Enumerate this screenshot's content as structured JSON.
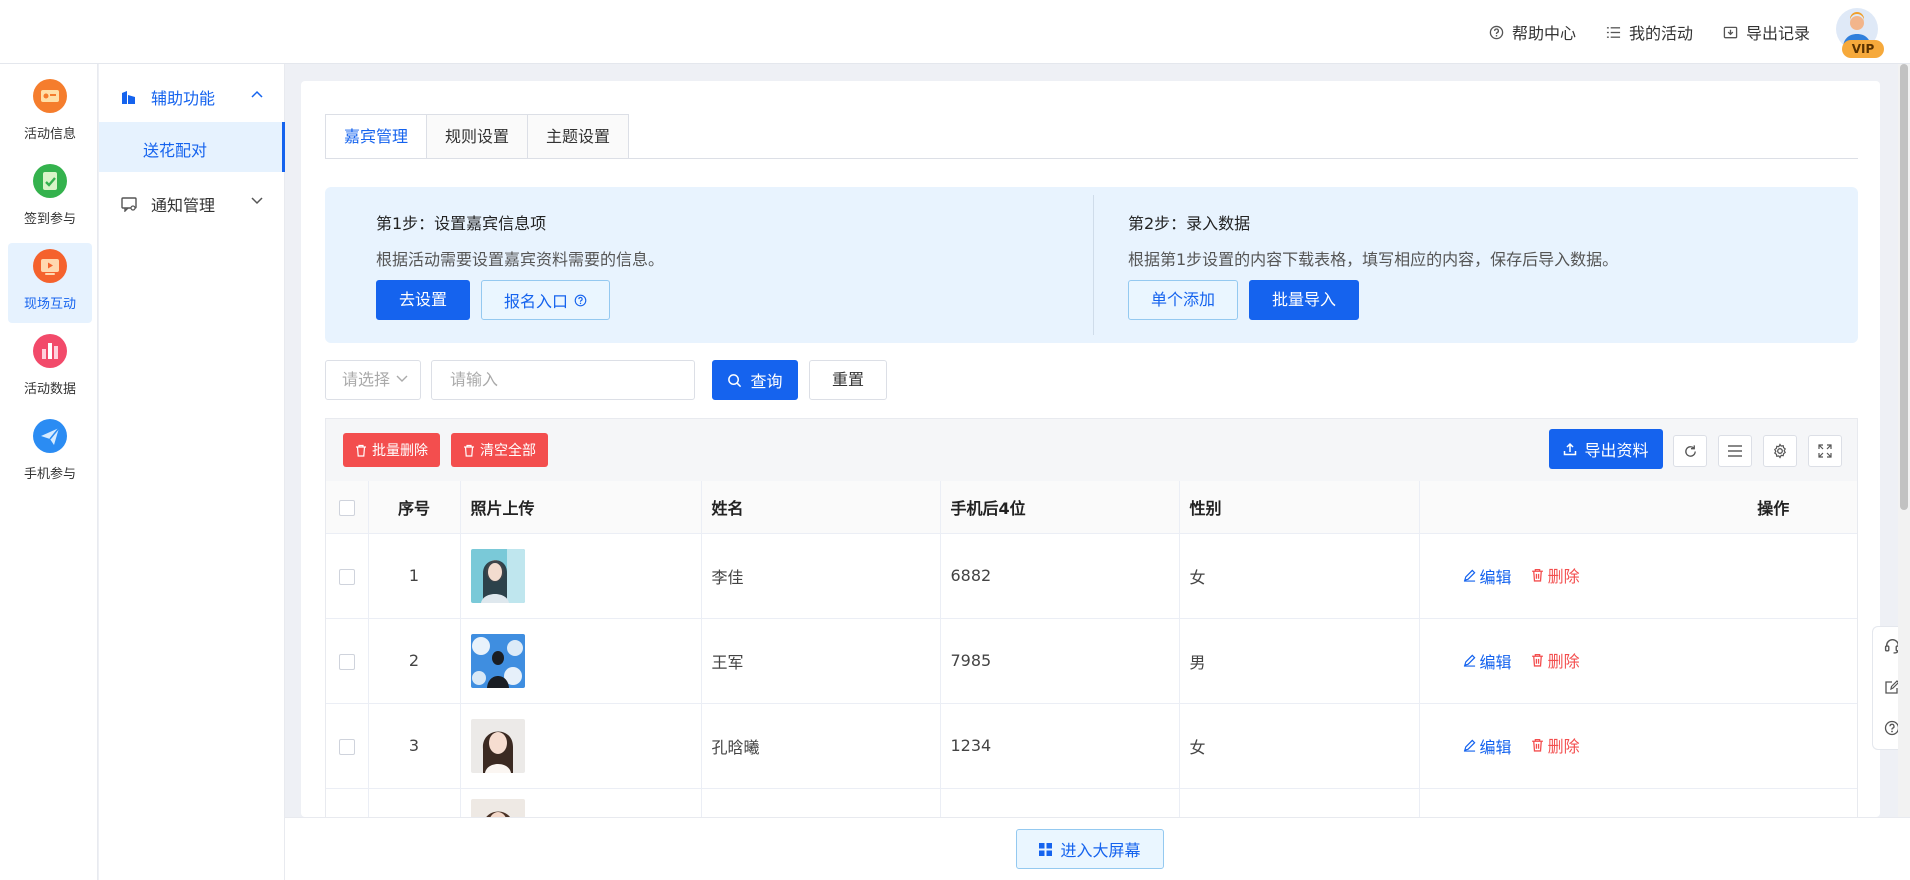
{
  "header": {
    "links": [
      {
        "label": "帮助中心",
        "icon": "help-circle-icon"
      },
      {
        "label": "我的活动",
        "icon": "list-icon"
      },
      {
        "label": "导出记录",
        "icon": "download-box-icon"
      }
    ],
    "vip_badge": "VIP"
  },
  "leftnav": {
    "items": [
      {
        "label": "活动信息",
        "icon": "ticket-icon",
        "color": "#f57d2d"
      },
      {
        "label": "签到参与",
        "icon": "checkin-icon",
        "color": "#34b24d"
      },
      {
        "label": "现场互动",
        "icon": "tv-icon",
        "color": "#f5622d",
        "active": true
      },
      {
        "label": "活动数据",
        "icon": "chart-icon",
        "color": "#f24a6a"
      },
      {
        "label": "手机参与",
        "icon": "paper-plane-icon",
        "color": "#2b8cf3"
      }
    ]
  },
  "subnav": {
    "group1": {
      "label": "辅助功能",
      "expanded": true
    },
    "selected": "送花配对",
    "group2": {
      "label": "通知管理",
      "expanded": false
    }
  },
  "tabs": [
    "嘉宾管理",
    "规则设置",
    "主题设置"
  ],
  "steps": {
    "step1": {
      "title": "第1步：设置嘉宾信息项",
      "desc": "根据活动需要设置嘉宾资料需要的信息。",
      "btn_primary": "去设置",
      "btn_outline": "报名入口"
    },
    "step2": {
      "title": "第2步：录入数据",
      "desc": "根据第1步设置的内容下载表格，填写相应的内容，保存后导入数据。",
      "btn_outline": "单个添加",
      "btn_primary": "批量导入"
    }
  },
  "filter": {
    "select_placeholder": "请选择",
    "input_placeholder": "请输入",
    "query": "查询",
    "reset": "重置"
  },
  "toolbar": {
    "batch_delete": "批量删除",
    "clear_all": "清空全部",
    "export": "导出资料"
  },
  "table": {
    "headers": {
      "index": "序号",
      "photo": "照片上传",
      "name": "姓名",
      "phone": "手机后4位",
      "gender": "性别",
      "ops": "操作"
    },
    "edit": "编辑",
    "delete": "删除",
    "rows": [
      {
        "index": "1",
        "name": "李佳",
        "phone": "6882",
        "gender": "女"
      },
      {
        "index": "2",
        "name": "王军",
        "phone": "7985",
        "gender": "男"
      },
      {
        "index": "3",
        "name": "孔晗曦",
        "phone": "1234",
        "gender": "女"
      }
    ]
  },
  "bottom": {
    "big_screen": "进入大屏幕"
  },
  "colors": {
    "primary": "#1563ee",
    "danger": "#f34e4e",
    "light_blue_bg": "#e8f3fe"
  }
}
